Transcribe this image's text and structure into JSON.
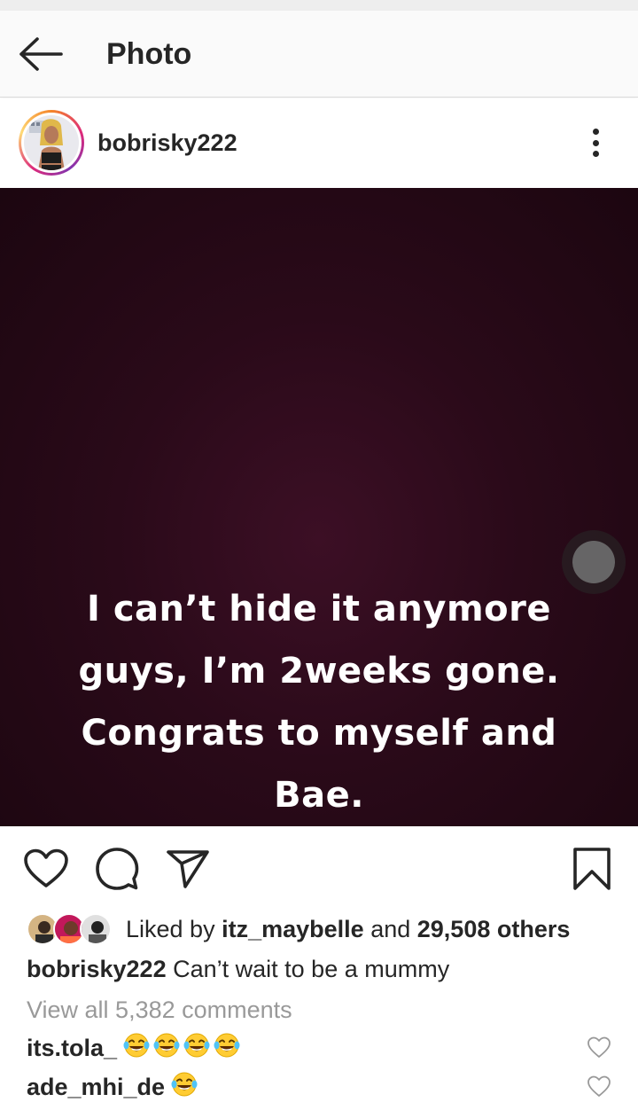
{
  "header": {
    "title": "Photo"
  },
  "post": {
    "username": "bobrisky222",
    "image_text": [
      "I can’t hide it anymore",
      "guys, I’m 2weeks gone.",
      "Congrats to myself and",
      "Bae."
    ],
    "likes": {
      "prefix": "Liked by",
      "first_liker": "itz_maybelle",
      "middle": "and",
      "others": "29,508 others"
    },
    "caption": {
      "username": "bobrisky222",
      "text": "Can’t wait to be a mummy"
    },
    "view_all_comments": "View all 5,382 comments",
    "comments": [
      {
        "username": "its.tola_",
        "emoji_count": 4
      },
      {
        "username": "ade_mhi_de",
        "emoji_count": 1
      }
    ]
  },
  "icons": {
    "back": "arrow-left-icon",
    "more": "more-vertical-icon",
    "like": "heart-icon",
    "comment": "comment-bubble-icon",
    "share": "paper-plane-icon",
    "save": "bookmark-icon",
    "emoji": "face-with-tears-of-joy-icon"
  },
  "colors": {
    "post_background": "#2a0a19",
    "avatar_ring": "#dd2a7b",
    "muted_text": "#999999",
    "emoji": "#ffcc33"
  }
}
